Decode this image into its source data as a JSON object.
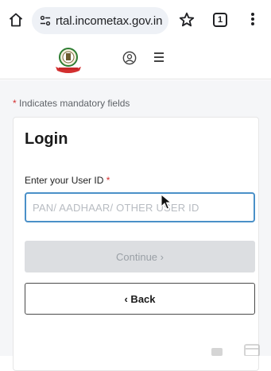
{
  "browser": {
    "url": "rtal.incometax.gov.in",
    "tab_count": "1",
    "icons": [
      "home-icon",
      "tune-icon",
      "star-icon",
      "tab-switcher-icon",
      "more-vert-icon"
    ]
  },
  "header": {
    "icons": [
      "emblem-logo",
      "account-icon",
      "hamburger-icon"
    ]
  },
  "form": {
    "mandatory_asterisk": "*",
    "mandatory_note": " Indicates mandatory fields",
    "title": "Login",
    "userid_label": "Enter your User ID ",
    "userid_asterisk": "*",
    "userid_placeholder": "PAN/ AADHAAR/ OTHER USER ID",
    "userid_value": "",
    "continue_label": "Continue ›",
    "back_label": "‹ Back"
  },
  "colors": {
    "accent_border": "#4a90c8",
    "mandatory": "#d32f2f",
    "disabled_button": "#dcdee1",
    "page_background": "#f5f6f8"
  }
}
